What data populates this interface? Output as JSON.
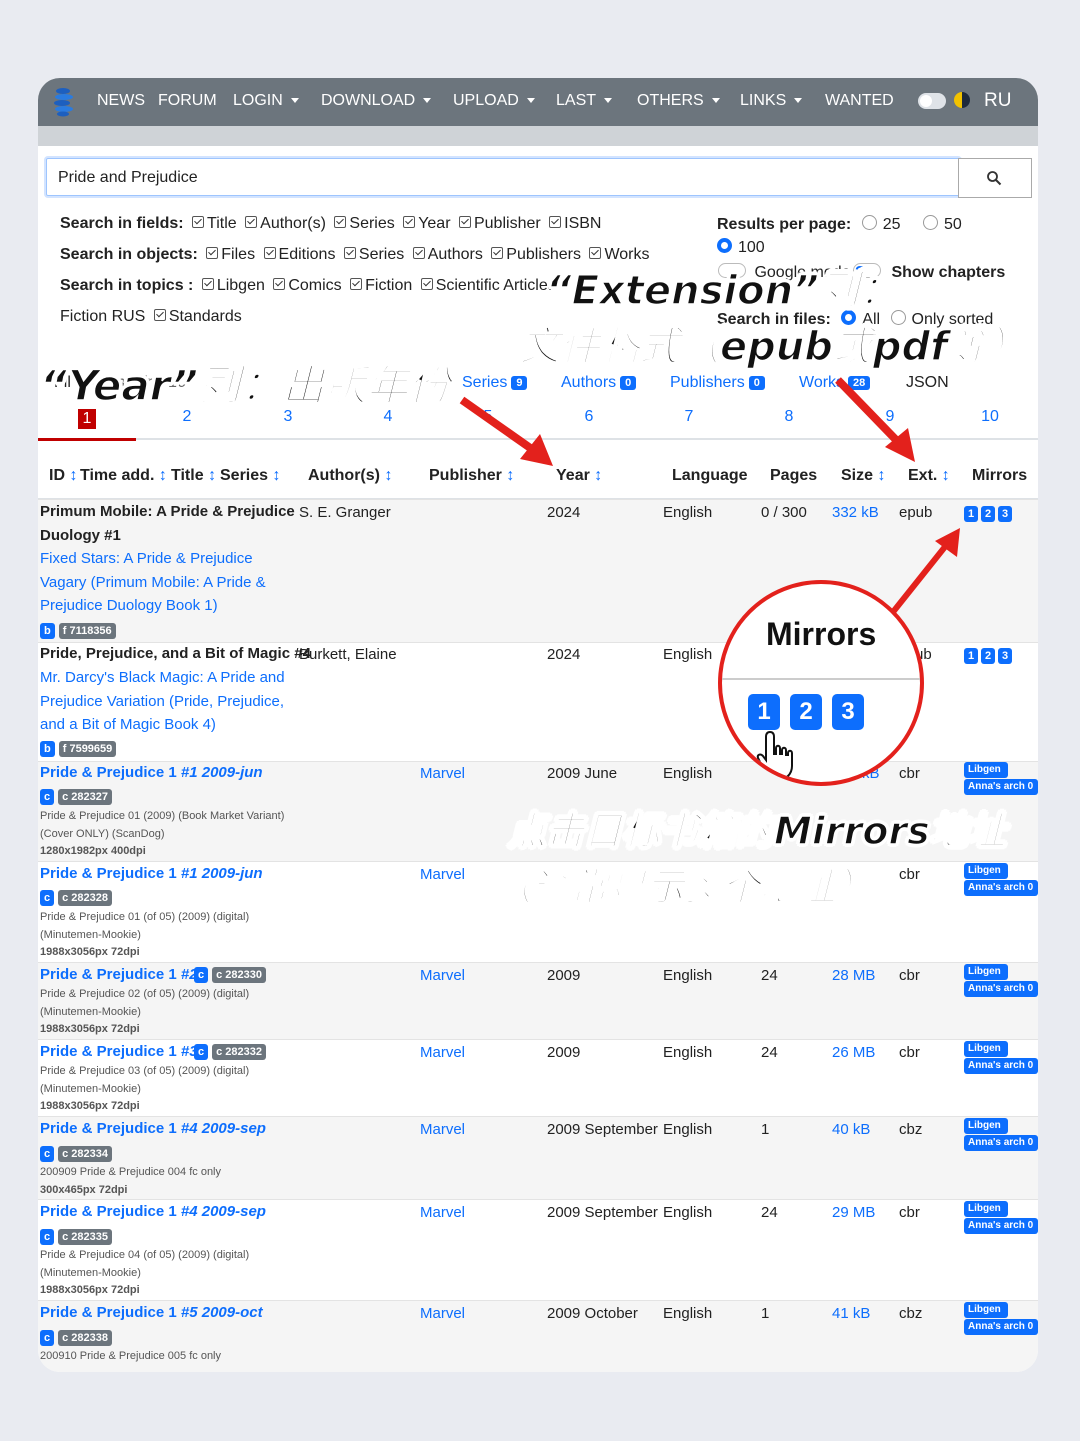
{
  "navbar": {
    "items": [
      "NEWS",
      "FORUM",
      "LOGIN",
      "DOWNLOAD",
      "UPLOAD",
      "LAST",
      "OTHERS",
      "LINKS",
      "WANTED"
    ],
    "lang": "RU"
  },
  "search": {
    "value": "Pride and Prejudice"
  },
  "options": {
    "fields_label": "Search in fields:",
    "fields": [
      "Title",
      "Author(s)",
      "Series",
      "Year",
      "Publisher",
      "ISBN"
    ],
    "objects_label": "Search in objects:",
    "objects": [
      "Files",
      "Editions",
      "Series",
      "Authors",
      "Publishers",
      "Works"
    ],
    "topics_label": "Search in topics :",
    "topics": [
      "Libgen",
      "Comics",
      "Fiction",
      "Scientific Articles"
    ],
    "topics_2": [
      "Standards"
    ],
    "fiction_rus": "Fiction RUS",
    "results_label": "Results per page:",
    "results": [
      "25",
      "50",
      "100"
    ],
    "show_chapters": "Show chapters",
    "google_mode": "Google mode",
    "search_files_label": "Search in files:",
    "all": "All",
    "only_sorted": "Only sorted",
    "help": "?"
  },
  "tabs": {
    "files_prefix": "Fil",
    "showing": "showing first 10",
    "items": [
      {
        "label": "Series",
        "count": "9"
      },
      {
        "label": "Authors",
        "count": "0"
      },
      {
        "label": "Publishers",
        "count": "0"
      },
      {
        "label": "Works",
        "count": "28"
      }
    ],
    "json": "JSON"
  },
  "pages": [
    "1",
    "2",
    "3",
    "4",
    "5",
    "6",
    "7",
    "8",
    "9",
    "10"
  ],
  "columns": [
    "ID",
    "Time add.",
    "Title",
    "Series",
    "Author(s)",
    "Publisher",
    "Year",
    "Language",
    "Pages",
    "Size",
    "Ext.",
    "Mirrors"
  ],
  "sort_arrow": "↕",
  "rows": [
    {
      "title": "Primum Mobile: A Pride & Prejudice",
      "title2": "Duology #1",
      "series_lines": [
        "Fixed Stars: A Pride & Prejudice",
        "Vagary (Primum Mobile: A Pride &",
        "Prejudice Duology Book 1)"
      ],
      "tag1": "b",
      "tag2": "f 7118356",
      "author": "S. E. Granger",
      "year": "2024",
      "language": "English",
      "pages": "0 / 300",
      "size": "332 kB",
      "ext": "epub"
    },
    {
      "title": "Pride, Prejudice, and a Bit of Magic #4",
      "series_lines": [
        "Mr. Darcy's Black Magic: A Pride and",
        "Prejudice Variation (Pride, Prejudice,",
        "and a Bit of Magic Book 4)"
      ],
      "tag1": "b",
      "tag2": "f 7599659",
      "author": "Burkett, Elaine",
      "year": "2024",
      "language": "English",
      "ext_partial": "ub"
    },
    {
      "title": "Pride & Prejudice 1 ",
      "issue": "#1 2009-jun",
      "tag1": "c",
      "tag2": "c 282327",
      "notes": [
        "Pride & Prejudice 01 (2009) (Book Market Variant)",
        "(Cover ONLY) (ScanDog)",
        "1280x1982px 400dpi"
      ],
      "publisher": "Marvel",
      "year": "2009 June",
      "language": "English",
      "size_partial": "kB",
      "ext": "cbr"
    },
    {
      "title": "Pride & Prejudice 1 ",
      "issue": "#1 2009-jun",
      "tag1": "c",
      "tag2": "c 282328",
      "notes": [
        "Pride & Prejudice 01 (of 05) (2009) (digital)",
        "(Minutemen-Mookie)",
        "1988x3056px 72dpi"
      ],
      "publisher": "Marvel",
      "ext": "cbr"
    },
    {
      "title": "Pride & Prejudice 1 ",
      "issue": "#2",
      "tag1": "c",
      "tag2": "c 282330",
      "notes": [
        "Pride & Prejudice 02 (of 05) (2009) (digital)",
        "(Minutemen-Mookie)",
        "1988x3056px 72dpi"
      ],
      "publisher": "Marvel",
      "year": "2009",
      "language": "English",
      "pages": "24",
      "size": "28 MB",
      "ext": "cbr"
    },
    {
      "title": "Pride & Prejudice 1 ",
      "issue": "#3",
      "tag1": "c",
      "tag2": "c 282332",
      "notes": [
        "Pride & Prejudice 03 (of 05) (2009) (digital)",
        "(Minutemen-Mookie)",
        "1988x3056px 72dpi"
      ],
      "publisher": "Marvel",
      "year": "2009",
      "language": "English",
      "pages": "24",
      "size": "26 MB",
      "ext": "cbr"
    },
    {
      "title": "Pride & Prejudice 1 ",
      "issue": "#4 2009-sep",
      "tag1": "c",
      "tag2": "c 282334",
      "notes": [
        "200909 Pride & Prejudice 004 fc only",
        "300x465px 72dpi"
      ],
      "publisher": "Marvel",
      "year": "2009 September",
      "language": "English",
      "pages": "1",
      "size": "40 kB",
      "ext": "cbz"
    },
    {
      "title": "Pride & Prejudice 1 ",
      "issue": "#4 2009-sep",
      "tag1": "c",
      "tag2": "c 282335",
      "notes": [
        "Pride & Prejudice 04 (of 05) (2009) (digital)",
        "(Minutemen-Mookie)",
        "1988x3056px 72dpi"
      ],
      "publisher": "Marvel",
      "year": "2009 September",
      "language": "English",
      "pages": "24",
      "size": "29 MB",
      "ext": "cbr"
    },
    {
      "title": "Pride & Prejudice 1 ",
      "issue": "#5 2009-oct",
      "tag1": "c",
      "tag2": "c 282338",
      "notes": [
        "200910 Pride & Prejudice 005 fc only"
      ],
      "publisher": "Marvel",
      "year": "2009 October",
      "language": "English",
      "pages": "1",
      "size": "41 kB",
      "ext": "cbz"
    }
  ],
  "mirrors": {
    "nums": [
      "1",
      "2",
      "3"
    ],
    "libgen": "Libgen",
    "annas": "Anna's arch 0"
  },
  "annotations": {
    "extension_title": "“Extension”列：",
    "extension_desc": "文件格式（epub或pdf等）",
    "year_note": "“Year”列：出版年份",
    "mirrors_zoom": "Mirrors",
    "click_note_1": "点击目标书籍的Mirrors地址",
    "click_note_2": "（通常显示多个地址）"
  },
  "colors": {
    "navbar": "#6c757d",
    "link": "#0d6efd",
    "accent_red": "#e3211c",
    "active_page": "#c00000"
  }
}
